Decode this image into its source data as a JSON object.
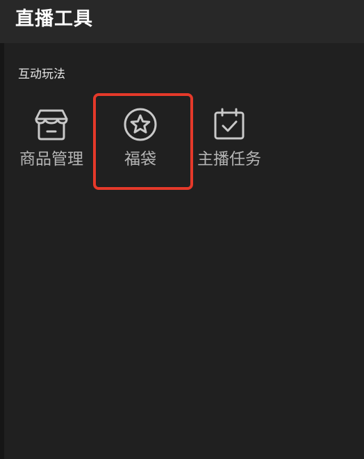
{
  "header": {
    "title": "直播工具"
  },
  "section": {
    "label": "互动玩法"
  },
  "tools": [
    {
      "label": "商品管理",
      "icon": "shop-icon"
    },
    {
      "label": "福袋",
      "icon": "star-circle-icon"
    },
    {
      "label": "主播任务",
      "icon": "calendar-check-icon"
    }
  ],
  "colors": {
    "background": "#202020",
    "header": "#282828",
    "highlight": "#e5392a",
    "icon": "#c9c9c9",
    "label": "#b5b5b5"
  }
}
